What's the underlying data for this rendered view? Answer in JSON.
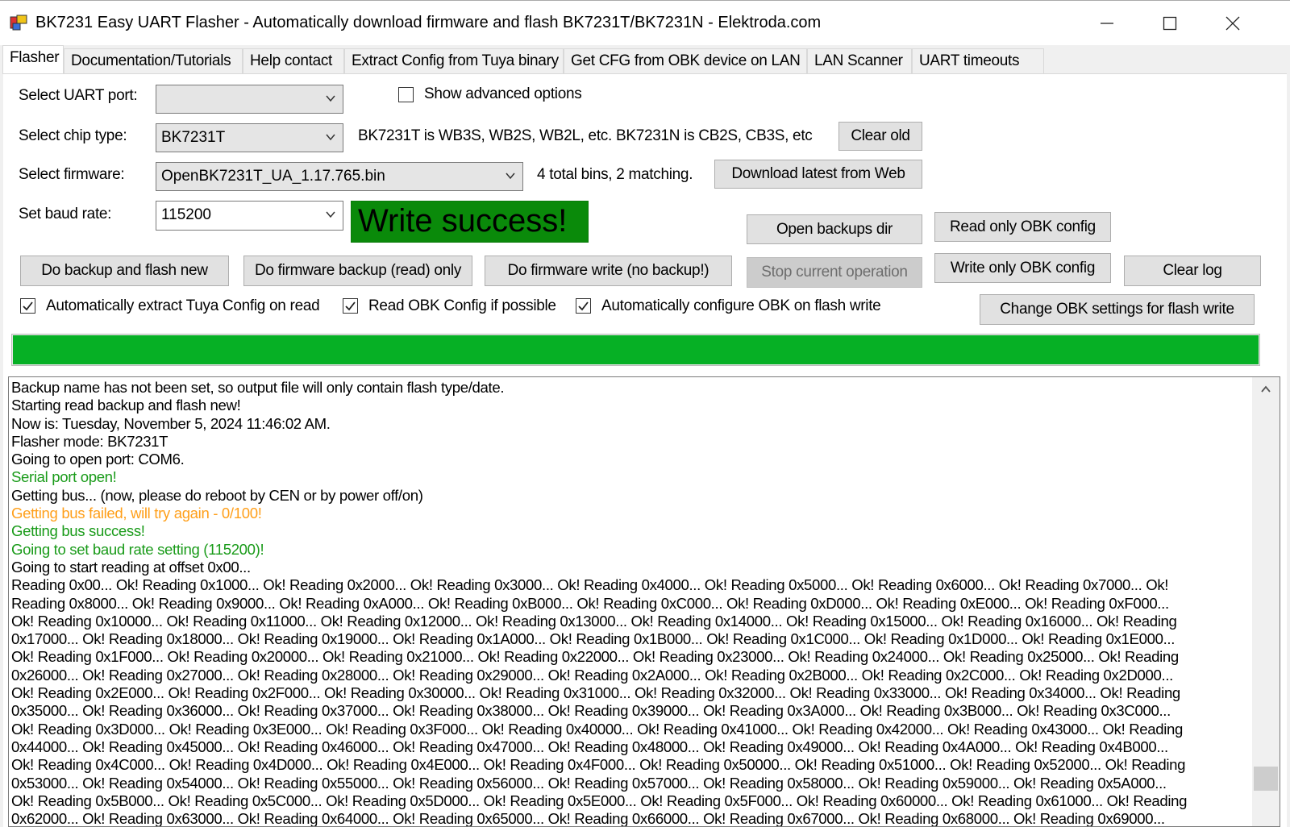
{
  "window": {
    "title": "BK7231 Easy UART Flasher - Automatically download firmware and flash BK7231T/BK7231N  - Elektroda.com",
    "minimize_icon": "minimize-icon",
    "maximize_icon": "maximize-icon",
    "close_icon": "close-icon"
  },
  "tabs": [
    {
      "label": "Flasher",
      "active": true
    },
    {
      "label": "Documentation/Tutorials"
    },
    {
      "label": "Help contact"
    },
    {
      "label": "Extract Config from Tuya binary"
    },
    {
      "label": "Get CFG from OBK device on LAN"
    },
    {
      "label": "LAN Scanner"
    },
    {
      "label": "UART timeouts"
    }
  ],
  "form": {
    "uart_port_label": "Select UART port:",
    "uart_port_value": "",
    "chip_type_label": "Select chip type:",
    "chip_type_value": "BK7231T",
    "chip_hint": "BK7231T is WB3S, WB2S, WB2L, etc. BK7231N is CB2S, CB3S, etc",
    "firmware_label": "Select firmware:",
    "firmware_value": "OpenBK7231T_UA_1.17.765.bin",
    "firmware_hint": "4 total bins, 2 matching.",
    "baud_label": "Set baud rate:",
    "baud_value": "115200",
    "show_advanced_label": "Show advanced options",
    "show_advanced_checked": false
  },
  "status_banner": "Write success!",
  "buttons": {
    "clear_old": "Clear old",
    "download_latest": "Download latest from Web",
    "open_backups": "Open backups dir",
    "read_only_obk": "Read only OBK config",
    "do_backup_flash": "Do backup and flash new",
    "do_firmware_backup": "Do firmware backup (read) only",
    "do_firmware_write": "Do firmware write (no backup!)",
    "stop_operation": "Stop current operation",
    "write_only_obk": "Write only OBK config",
    "clear_log": "Clear log",
    "change_obk_settings": "Change OBK settings for flash write"
  },
  "options": {
    "auto_extract_label": "Automatically extract Tuya Config on read",
    "auto_extract_checked": true,
    "read_obk_label": "Read OBK Config if possible",
    "read_obk_checked": true,
    "auto_configure_label": "Automatically configure OBK on flash write",
    "auto_configure_checked": true
  },
  "progress": {
    "fraction": 1.0,
    "color": "#06b025"
  },
  "colors": {
    "log_default": "#000000",
    "log_success": "#1a9b1a",
    "log_warning": "#ff9f1a",
    "banner_bg": "#0a8a0a"
  },
  "log": [
    {
      "text": "Backup name has not been set, so output file will only contain flash type/date.",
      "level": "info"
    },
    {
      "text": "Starting read backup and flash new!",
      "level": "info"
    },
    {
      "text": "Now is: Tuesday, November 5, 2024 11:46:02 AM.",
      "level": "info"
    },
    {
      "text": "Flasher mode: BK7231T",
      "level": "info"
    },
    {
      "text": "Going to open port: COM6.",
      "level": "info"
    },
    {
      "text": "Serial port open!",
      "level": "success"
    },
    {
      "text": "Getting bus... (now, please do reboot by CEN or by power off/on)",
      "level": "info"
    },
    {
      "text": "Getting bus failed, will try again - 0/100!",
      "level": "warning"
    },
    {
      "text": "Getting bus success!",
      "level": "success"
    },
    {
      "text": "Going to set baud rate setting (115200)!",
      "level": "success"
    },
    {
      "text": "Going to start reading at offset 0x00...",
      "level": "info"
    },
    {
      "text": "Reading 0x00... Ok! Reading 0x1000... Ok! Reading 0x2000... Ok! Reading 0x3000... Ok! Reading 0x4000... Ok! Reading 0x5000... Ok! Reading 0x6000... Ok! Reading 0x7000... Ok!",
      "level": "info"
    },
    {
      "text": "Reading 0x8000... Ok! Reading 0x9000... Ok! Reading 0xA000... Ok! Reading 0xB000... Ok! Reading 0xC000... Ok! Reading 0xD000... Ok! Reading 0xE000... Ok! Reading 0xF000...",
      "level": "info"
    },
    {
      "text": "Ok! Reading 0x10000... Ok! Reading 0x11000... Ok! Reading 0x12000... Ok! Reading 0x13000... Ok! Reading 0x14000... Ok! Reading 0x15000... Ok! Reading 0x16000... Ok! Reading",
      "level": "info"
    },
    {
      "text": "0x17000... Ok! Reading 0x18000... Ok! Reading 0x19000... Ok! Reading 0x1A000... Ok! Reading 0x1B000... Ok! Reading 0x1C000... Ok! Reading 0x1D000... Ok! Reading 0x1E000...",
      "level": "info"
    },
    {
      "text": "Ok! Reading 0x1F000... Ok! Reading 0x20000... Ok! Reading 0x21000... Ok! Reading 0x22000... Ok! Reading 0x23000... Ok! Reading 0x24000... Ok! Reading 0x25000... Ok! Reading",
      "level": "info"
    },
    {
      "text": "0x26000... Ok! Reading 0x27000... Ok! Reading 0x28000... Ok! Reading 0x29000... Ok! Reading 0x2A000... Ok! Reading 0x2B000... Ok! Reading 0x2C000... Ok! Reading 0x2D000...",
      "level": "info"
    },
    {
      "text": "Ok! Reading 0x2E000... Ok! Reading 0x2F000... Ok! Reading 0x30000... Ok! Reading 0x31000... Ok! Reading 0x32000... Ok! Reading 0x33000... Ok! Reading 0x34000... Ok! Reading",
      "level": "info"
    },
    {
      "text": "0x35000... Ok! Reading 0x36000... Ok! Reading 0x37000... Ok! Reading 0x38000... Ok! Reading 0x39000... Ok! Reading 0x3A000... Ok! Reading 0x3B000... Ok! Reading 0x3C000...",
      "level": "info"
    },
    {
      "text": "Ok! Reading 0x3D000... Ok! Reading 0x3E000... Ok! Reading 0x3F000... Ok! Reading 0x40000... Ok! Reading 0x41000... Ok! Reading 0x42000... Ok! Reading 0x43000... Ok! Reading",
      "level": "info"
    },
    {
      "text": "0x44000... Ok! Reading 0x45000... Ok! Reading 0x46000... Ok! Reading 0x47000... Ok! Reading 0x48000... Ok! Reading 0x49000... Ok! Reading 0x4A000... Ok! Reading 0x4B000...",
      "level": "info"
    },
    {
      "text": "Ok! Reading 0x4C000... Ok! Reading 0x4D000... Ok! Reading 0x4E000... Ok! Reading 0x4F000... Ok! Reading 0x50000... Ok! Reading 0x51000... Ok! Reading 0x52000... Ok! Reading",
      "level": "info"
    },
    {
      "text": "0x53000... Ok! Reading 0x54000... Ok! Reading 0x55000... Ok! Reading 0x56000... Ok! Reading 0x57000... Ok! Reading 0x58000... Ok! Reading 0x59000... Ok! Reading 0x5A000...",
      "level": "info"
    },
    {
      "text": "Ok! Reading 0x5B000... Ok! Reading 0x5C000... Ok! Reading 0x5D000... Ok! Reading 0x5E000... Ok! Reading 0x5F000... Ok! Reading 0x60000... Ok! Reading 0x61000... Ok! Reading",
      "level": "info"
    },
    {
      "text": "0x62000... Ok! Reading 0x63000... Ok! Reading 0x64000... Ok! Reading 0x65000... Ok! Reading 0x66000... Ok! Reading 0x67000... Ok! Reading 0x68000... Ok! Reading 0x69000...",
      "level": "info"
    }
  ]
}
